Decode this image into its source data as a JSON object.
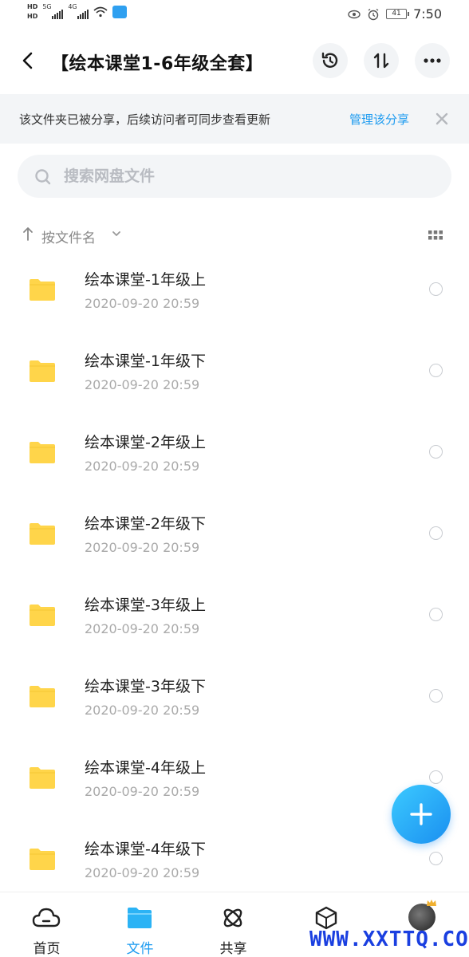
{
  "status_bar": {
    "hd1": "HD",
    "hd2": "HD",
    "net1": "5G",
    "net2": "4G",
    "battery": "41",
    "time": "7:50"
  },
  "header": {
    "title": "【绘本课堂1-6年级全套】"
  },
  "notice": {
    "text": "该文件夹已被分享，后续访问者可同步查看更新",
    "link": "管理该分享"
  },
  "search": {
    "placeholder": "搜索网盘文件"
  },
  "sort": {
    "label": "按文件名"
  },
  "files": [
    {
      "name": "绘本课堂-1年级上",
      "date": "2020-09-20  20:59"
    },
    {
      "name": "绘本课堂-1年级下",
      "date": "2020-09-20  20:59"
    },
    {
      "name": "绘本课堂-2年级上",
      "date": "2020-09-20  20:59"
    },
    {
      "name": "绘本课堂-2年级下",
      "date": "2020-09-20  20:59"
    },
    {
      "name": "绘本课堂-3年级上",
      "date": "2020-09-20  20:59"
    },
    {
      "name": "绘本课堂-3年级下",
      "date": "2020-09-20  20:59"
    },
    {
      "name": "绘本课堂-4年级上",
      "date": "2020-09-20  20:59"
    },
    {
      "name": "绘本课堂-4年级下",
      "date": "2020-09-20  20:59"
    }
  ],
  "nav": {
    "home": "首页",
    "files": "文件",
    "share": "共享",
    "box": ""
  },
  "watermark": "WWW.XXTTQ.COM",
  "colors": {
    "accent": "#1d9bf0",
    "folder": "#ffd54a",
    "notice_bg": "#f3f5f7"
  }
}
